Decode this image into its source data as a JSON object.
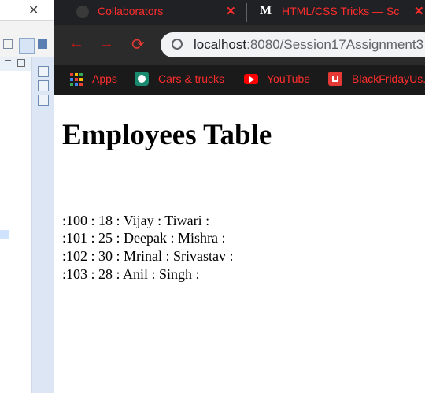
{
  "ide": {
    "tabs_close": "✕"
  },
  "browser": {
    "tabs": [
      {
        "title": "Collaborators",
        "icon": "github-icon",
        "close": "✕"
      },
      {
        "title": "HTML/CSS Tricks — Sc",
        "icon": "medium-m-icon",
        "icon_text": "M",
        "close": "✕"
      }
    ],
    "nav": {
      "back": "←",
      "forward": "→",
      "reload": "⟳"
    },
    "address": {
      "host": "localhost",
      "path": ":8080/Session17Assignment3"
    },
    "bookmarks": [
      {
        "label": "Apps",
        "icon": "apps-grid-icon"
      },
      {
        "label": "Cars & trucks",
        "icon": "cars-app-icon"
      },
      {
        "label": "YouTube",
        "icon": "youtube-icon"
      },
      {
        "label": "BlackFridayUs.",
        "icon": "shopping-bag-icon"
      }
    ]
  },
  "page": {
    "title": "Employees Table",
    "rows": [
      ":100 : 18 : Vijay : Tiwari :",
      ":101 : 25 : Deepak : Mishra :",
      ":102 : 30 : Mrinal : Srivastav :",
      ":103 : 28 : Anil : Singh :"
    ]
  }
}
